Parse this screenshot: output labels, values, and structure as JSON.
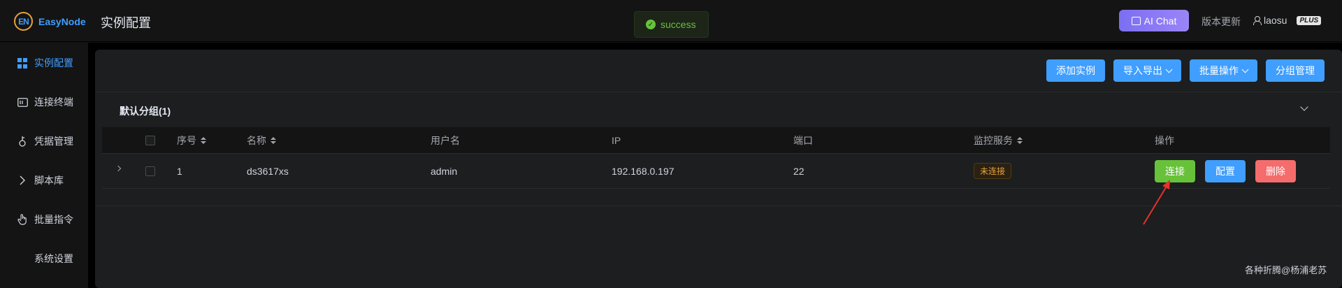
{
  "header": {
    "logo_mark": "EN",
    "app_name": "EasyNode",
    "page_title": "实例配置",
    "toast": "success",
    "ai_chat_label": "AI Chat",
    "version_label": "版本更新",
    "username": "laosu",
    "plan_badge": "PLUS"
  },
  "sidebar": {
    "items": [
      {
        "label": "实例配置",
        "icon": "grid-icon",
        "active": true
      },
      {
        "label": "连接终端",
        "icon": "terminal-icon"
      },
      {
        "label": "凭据管理",
        "icon": "key-icon"
      },
      {
        "label": "脚本库",
        "icon": "chevron-right-icon"
      },
      {
        "label": "批量指令",
        "icon": "pointer-icon"
      },
      {
        "label": "系统设置",
        "icon": ""
      }
    ]
  },
  "toolbar": {
    "add_instance": "添加实例",
    "import_export": "导入导出",
    "batch_ops": "批量操作",
    "group_manage": "分组管理"
  },
  "group": {
    "title": "默认分组(1)"
  },
  "table": {
    "columns": [
      "序号",
      "名称",
      "用户名",
      "IP",
      "端口",
      "监控服务",
      "操作"
    ],
    "rows": [
      {
        "index": "1",
        "name": "ds3617xs",
        "username": "admin",
        "ip": "192.168.0.197",
        "port": "22",
        "monitor_status": "未连接",
        "actions": {
          "connect": "连接",
          "config": "配置",
          "delete": "删除"
        }
      }
    ]
  },
  "watermark": "各种折腾@杨浦老苏",
  "colors": {
    "primary": "#409eff",
    "success": "#67c23a",
    "danger": "#f56c6c",
    "warning": "#e6a23c",
    "ai_chat": "#8c7af5",
    "annotation_arrow": "#e8312a"
  }
}
